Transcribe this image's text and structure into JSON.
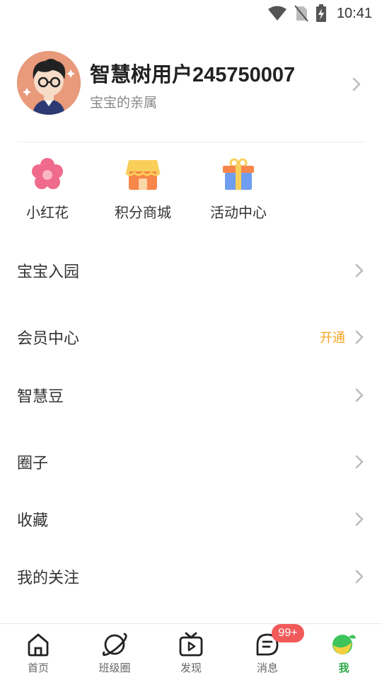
{
  "status_bar": {
    "time": "10:41",
    "icons": [
      "wifi-icon",
      "no-sim-icon",
      "battery-charging-icon"
    ]
  },
  "profile": {
    "username": "智慧树用户245750007",
    "role": "宝宝的亲属"
  },
  "quick_actions": [
    {
      "label": "小红花",
      "icon": "flower-icon"
    },
    {
      "label": "积分商城",
      "icon": "shop-icon"
    },
    {
      "label": "活动中心",
      "icon": "gift-icon"
    }
  ],
  "menu": {
    "baby_enroll": "宝宝入园",
    "member_center": "会员中心",
    "member_action": "开通",
    "wisdom_beans": "智慧豆",
    "circle": "圈子",
    "favorites": "收藏",
    "following": "我的关注"
  },
  "tabbar": {
    "home": "首页",
    "class_circle": "班级圈",
    "discover": "发现",
    "messages": "消息",
    "messages_badge": "99+",
    "me": "我"
  },
  "colors": {
    "accent_green": "#2aa845",
    "badge_red": "#f25a5a",
    "action_yellow": "#f5a623"
  }
}
